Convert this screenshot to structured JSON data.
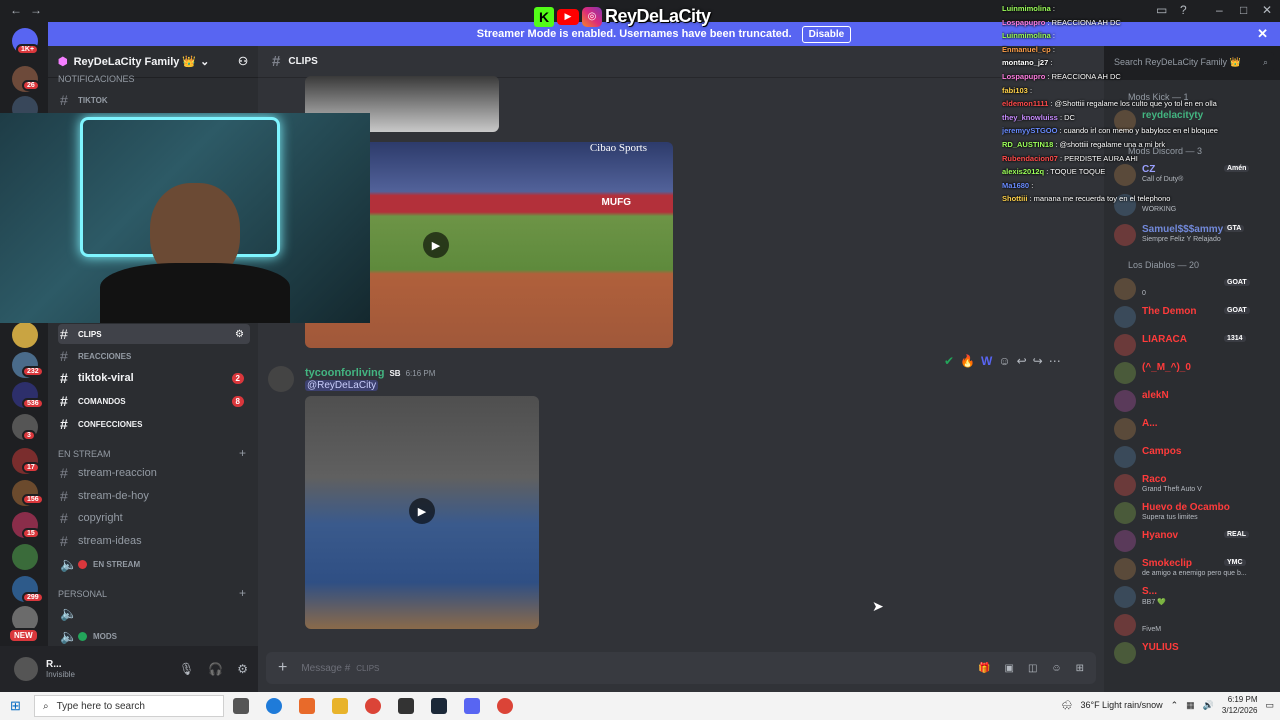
{
  "window": {
    "back_icon": "arrow-left-icon",
    "forward_icon": "arrow-right-icon",
    "controls": [
      "inbox-icon",
      "help-icon",
      "minimize-icon",
      "maximize-icon",
      "close-icon"
    ]
  },
  "banner": {
    "text": "Streamer Mode is enabled. Usernames have been truncated.",
    "disable_label": "Disable",
    "close_icon": "close-icon"
  },
  "logo": {
    "brand": "ReyDeLaCity",
    "k_letter": "K"
  },
  "rail": {
    "top_badge": "1K+",
    "badges": [
      "26",
      "232",
      "536",
      "3",
      "17",
      "156",
      "15",
      "299",
      "NEW"
    ]
  },
  "sidebar": {
    "server_name": "ReyDeLaCity Family 👑",
    "categories": {
      "notificaciones": "NOTIFICACIONES",
      "en_stream": "EN STREAM",
      "personal": "PERSONAL"
    },
    "channels": {
      "tiktok": "TIKTOK",
      "clips": "CLIPS",
      "reacciones": "REACCIONES",
      "tiktok_viral": "tiktok-viral",
      "tiktok_viral_badge": "2",
      "comandos": "COMANDOS",
      "comandos_badge": "8",
      "confecciones": "CONFECCIONES",
      "stream_reaccion": "stream-reaccion",
      "stream_de_hoy": "stream-de-hoy",
      "copyright": "copyright",
      "stream_ideas": "stream-ideas",
      "en_stream_voice": "EN STREAM",
      "mods": "MODS"
    }
  },
  "user": {
    "name": "R...",
    "status": "Invisible"
  },
  "chat": {
    "channel_name": "CLIPS",
    "message": {
      "author": "tycoonforliving",
      "tag": "SB",
      "time": "6:16 PM",
      "mention": "@ReyDeLaCity"
    },
    "composer_placeholder": "Message #",
    "composer_channel": "CLIPS",
    "video_brand": "Cibao Sports",
    "video_banner": "MUFG"
  },
  "search": {
    "placeholder": "Search ReyDeLaCity Family 👑"
  },
  "members": {
    "groups": [
      {
        "label": "Mods Kick — 1",
        "members": [
          {
            "name": "reydelacityty",
            "status": "",
            "color": "#43b581"
          }
        ]
      },
      {
        "label": "Mods Discord — 3",
        "members": [
          {
            "name": "CZ",
            "status": "Call of Duty®",
            "color": "#9aa0ff",
            "tag": "Amén"
          },
          {
            "name": "",
            "status": "WORKING",
            "color": "#9aa0ff"
          },
          {
            "name": "Samuel$$$ammy",
            "status": "Siempre Feliz Y Relajado",
            "color": "#7289da",
            "tag": "GTA"
          }
        ]
      },
      {
        "label": "Los Diablos — 20",
        "members": [
          {
            "name": "",
            "status": "0",
            "color": "#ff5a5a",
            "tag": "GOAT"
          },
          {
            "name": "The Demon",
            "status": "",
            "color": "#ff3b3b",
            "tag": "GOAT"
          },
          {
            "name": "LIARACA",
            "status": "",
            "color": "#ff3b3b",
            "tag": "1314"
          },
          {
            "name": "(^_M_^)_0",
            "status": "",
            "color": "#ff3b3b"
          },
          {
            "name": "alekN",
            "status": "",
            "color": "#ff3b3b"
          },
          {
            "name": "A...",
            "status": "",
            "color": "#ff3b3b"
          },
          {
            "name": "Campos",
            "status": "",
            "color": "#ff3b3b"
          },
          {
            "name": "Raco",
            "status": "Grand Theft Auto V",
            "color": "#ff3b3b"
          },
          {
            "name": "Huevo de Ocambo",
            "status": "Supera tus limites",
            "color": "#ff3b3b"
          },
          {
            "name": "Hyanov",
            "status": "",
            "color": "#ff3b3b",
            "tag": "REAL"
          },
          {
            "name": "Smokeclip",
            "status": "de amigo a enemigo pero que b...",
            "color": "#ff3b3b",
            "tag": "YMC"
          },
          {
            "name": "S...",
            "status": "BB7 💚",
            "color": "#ff3b3b"
          },
          {
            "name": "",
            "status": "FiveM",
            "color": "#ff3b3b"
          },
          {
            "name": "YULIUS",
            "status": "",
            "color": "#ff3b3b"
          }
        ]
      }
    ]
  },
  "overlay_chat": [
    {
      "user": "Luinmimolina",
      "msg": ":",
      "color": "#9cff5a"
    },
    {
      "user": "Lospapupro",
      "msg": ": REACCIONA AH DC",
      "color": "#ff7de0"
    },
    {
      "user": "Luinmimolina",
      "msg": ":",
      "color": "#9cff5a"
    },
    {
      "user": "Enmanuel_cp",
      "msg": ":",
      "color": "#ffa04a"
    },
    {
      "user": "montano_j27",
      "msg": ":",
      "color": "#ffffff"
    },
    {
      "user": "Lospapupro",
      "msg": ": REACCIONA AH DC",
      "color": "#ff7de0"
    },
    {
      "user": "fabi103",
      "msg": ":",
      "color": "#ffd24a"
    },
    {
      "user": "eldemon1111",
      "msg": ": @Shottiii regalame los culto que yo tol en en olla",
      "color": "#ff4a4a"
    },
    {
      "user": "they_knowluiss",
      "msg": ": DC",
      "color": "#c88cff"
    },
    {
      "user": "jeremyySTGOO",
      "msg": ": cuando irl con memo y babylocc en el bloquee",
      "color": "#6a8cff"
    },
    {
      "user": "RD_AUSTIN18",
      "msg": ": @shottiii regalame una a mi brk",
      "color": "#9cff5a"
    },
    {
      "user": "Rubendacion07",
      "msg": ": PERDISTE AURA AHI",
      "color": "#ff4a4a"
    },
    {
      "user": "alexis2012q",
      "msg": ": TOQUE TOQUE",
      "color": "#9cff5a"
    },
    {
      "user": "Ma1680",
      "msg": ":",
      "color": "#6a8cff"
    },
    {
      "user": "Shottiii",
      "msg": ": manana me recuerda toy en el telephono",
      "color": "#ffd24a"
    }
  ],
  "taskbar": {
    "search_placeholder": "Type here to search",
    "weather": "36°F  Light rain/snow",
    "time": "6:19 PM",
    "date": "3/12/2026"
  },
  "colors": {
    "blurple": "#5865f2",
    "sidebar": "#2b2d31",
    "chat_bg": "#313338",
    "red_badge": "#da373c"
  }
}
